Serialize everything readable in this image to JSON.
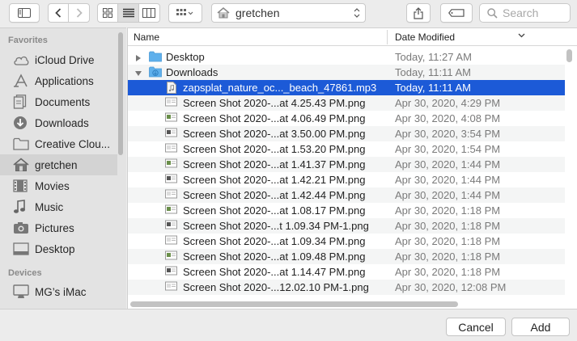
{
  "toolbar": {
    "location": "gretchen",
    "search_placeholder": "Search"
  },
  "sidebar": {
    "favorites_label": "Favorites",
    "devices_label": "Devices",
    "items": [
      {
        "label": "iCloud Drive",
        "icon": "cloud-icon"
      },
      {
        "label": "Applications",
        "icon": "applications-icon"
      },
      {
        "label": "Documents",
        "icon": "documents-icon"
      },
      {
        "label": "Downloads",
        "icon": "downloads-icon"
      },
      {
        "label": "Creative Clou...",
        "icon": "folder-icon"
      },
      {
        "label": "gretchen",
        "icon": "home-icon"
      },
      {
        "label": "Movies",
        "icon": "movies-icon"
      },
      {
        "label": "Music",
        "icon": "music-icon"
      },
      {
        "label": "Pictures",
        "icon": "pictures-icon"
      },
      {
        "label": "Desktop",
        "icon": "desktop-icon"
      }
    ],
    "devices": [
      {
        "label": "MG’s iMac",
        "icon": "imac-icon"
      }
    ]
  },
  "columns": {
    "name": "Name",
    "date": "Date Modified"
  },
  "rows": [
    {
      "name": "Desktop",
      "date": "Today, 11:27 AM",
      "type": "folder",
      "expanded": false
    },
    {
      "name": "Downloads",
      "date": "Today, 11:11 AM",
      "type": "downloads-folder",
      "expanded": true
    },
    {
      "name": "zapsplat_nature_oc..._beach_47861.mp3",
      "date": "Today, 11:11 AM",
      "type": "audio",
      "selected": true
    },
    {
      "name": "Screen Shot 2020-...at 4.25.43 PM.png",
      "date": "Apr 30, 2020, 4:29 PM",
      "type": "image"
    },
    {
      "name": "Screen Shot 2020-...at 4.06.49 PM.png",
      "date": "Apr 30, 2020, 4:08 PM",
      "type": "image"
    },
    {
      "name": "Screen Shot 2020-...at 3.50.00 PM.png",
      "date": "Apr 30, 2020, 3:54 PM",
      "type": "image"
    },
    {
      "name": "Screen Shot 2020-...at 1.53.20 PM.png",
      "date": "Apr 30, 2020, 1:54 PM",
      "type": "image"
    },
    {
      "name": "Screen Shot 2020-...at 1.41.37 PM.png",
      "date": "Apr 30, 2020, 1:44 PM",
      "type": "image"
    },
    {
      "name": "Screen Shot 2020-...at 1.42.21 PM.png",
      "date": "Apr 30, 2020, 1:44 PM",
      "type": "image"
    },
    {
      "name": "Screen Shot 2020-...at 1.42.44 PM.png",
      "date": "Apr 30, 2020, 1:44 PM",
      "type": "image"
    },
    {
      "name": "Screen Shot 2020-...at 1.08.17 PM.png",
      "date": "Apr 30, 2020, 1:18 PM",
      "type": "image"
    },
    {
      "name": "Screen Shot 2020-...t 1.09.34 PM-1.png",
      "date": "Apr 30, 2020, 1:18 PM",
      "type": "image"
    },
    {
      "name": "Screen Shot 2020-...at 1.09.34 PM.png",
      "date": "Apr 30, 2020, 1:18 PM",
      "type": "image"
    },
    {
      "name": "Screen Shot 2020-...at 1.09.48 PM.png",
      "date": "Apr 30, 2020, 1:18 PM",
      "type": "image"
    },
    {
      "name": "Screen Shot 2020-...at 1.14.47 PM.png",
      "date": "Apr 30, 2020, 1:18 PM",
      "type": "image"
    },
    {
      "name": "Screen Shot 2020-...12.02.10 PM-1.png",
      "date": "Apr 30, 2020, 12:08 PM",
      "type": "image"
    }
  ],
  "buttons": {
    "cancel": "Cancel",
    "add": "Add"
  },
  "colors": {
    "selection": "#1c5ad7",
    "folder_blue": "#5fb0ec"
  }
}
